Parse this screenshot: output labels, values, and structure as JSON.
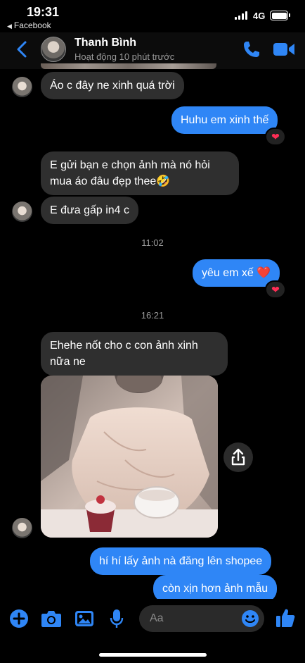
{
  "status_bar": {
    "time": "19:31",
    "back_app": "Facebook",
    "network": "4G"
  },
  "header": {
    "name": "Thanh Bình",
    "activity": "Hoạt động 10 phút trước"
  },
  "messages": {
    "m1": "Áo c đây ne xinh quá trời",
    "m2": "Huhu em xinh thế",
    "m3_line1": "E gửi bạn e chọn ảnh mà nó hỏi",
    "m3_line2": "mua áo đâu đẹp thee🤣",
    "m4": "E đưa gấp in4 c",
    "m5": "yêu em xế ❤️",
    "m6_line1": "Ehehe nốt cho c con ảnh xinh",
    "m6_line2": "nữa ne",
    "m7": "hí hí lấy ảnh nà đăng lên shopee",
    "m8": "còn xịn hơn ảnh mẫu"
  },
  "timestamps": {
    "t1": "11:02",
    "t2": "16:21"
  },
  "reactions": {
    "r1": "❤",
    "r2": "❤"
  },
  "composer": {
    "placeholder": "Aa"
  },
  "colors": {
    "outgoing": "#2f86f6",
    "incoming": "#2f2f2f",
    "accent": "#2f86f6"
  },
  "icons": [
    "back-chevron",
    "phone",
    "video-camera",
    "share",
    "plus",
    "camera",
    "image",
    "microphone",
    "emoji",
    "thumbs-up"
  ]
}
